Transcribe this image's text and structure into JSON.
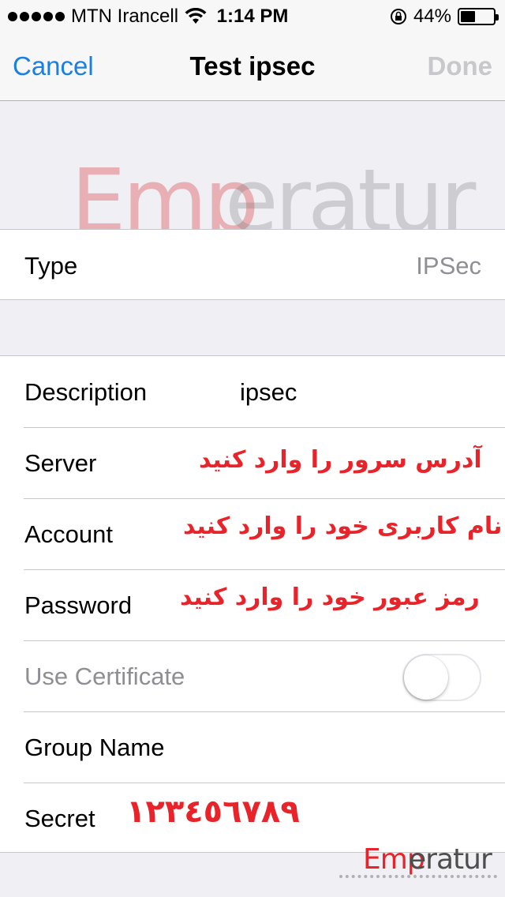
{
  "status_bar": {
    "carrier": "MTN Irancell",
    "time": "1:14 PM",
    "battery": "44%",
    "battery_level": 0.44
  },
  "nav": {
    "cancel": "Cancel",
    "title": "Test ipsec",
    "done": "Done"
  },
  "type_row": {
    "label": "Type",
    "value": "IPSec"
  },
  "rows": {
    "description": {
      "label": "Description",
      "value": "ipsec"
    },
    "server": {
      "label": "Server",
      "annotation": "آدرس سرور را وارد کنید"
    },
    "account": {
      "label": "Account",
      "annotation": "نام کاربری خود را وارد کنید"
    },
    "password": {
      "label": "Password",
      "annotation": "رمز عبور خود را وارد کنید"
    },
    "use_certificate": {
      "label": "Use Certificate",
      "on": false
    },
    "group_name": {
      "label": "Group Name"
    },
    "secret": {
      "label": "Secret",
      "annotation": "١٢٣٤٥٦٧٨٩"
    }
  },
  "watermark": {
    "brand_part1": "Emp",
    "brand_part2": "eratur"
  },
  "colors": {
    "accent": "#1a7fe0",
    "annotation": "#e8232a",
    "disabled": "#8e8e93"
  }
}
